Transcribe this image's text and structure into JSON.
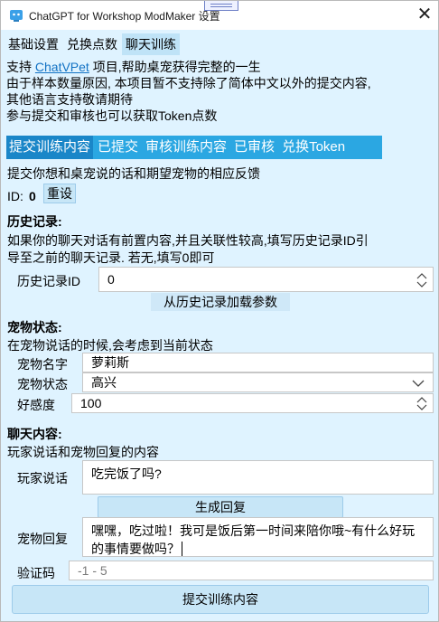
{
  "window": {
    "title": "ChatGPT for Workshop ModMaker 设置"
  },
  "main_tabs": [
    {
      "label": "基础设置"
    },
    {
      "label": "兑换点数"
    },
    {
      "label": "聊天训练"
    }
  ],
  "intro": {
    "line1_prefix": "支持 ",
    "line1_link": "ChatVPet",
    "line1_suffix": " 项目,帮助桌宠获得完整的一生",
    "line2": "由于样本数量原因, 本项目暂不支持除了简体中文以外的提交内容,",
    "line3": "其他语言支持敬请期待",
    "line4": "参与提交和审核也可以获取Token点数"
  },
  "sub_tabs": [
    {
      "label": "提交训练内容"
    },
    {
      "label": "已提交"
    },
    {
      "label": "审核训练内容"
    },
    {
      "label": "已审核"
    },
    {
      "label": "兑换Token"
    }
  ],
  "form": {
    "description": "提交你想和桌宠说的话和期望宠物的相应反馈",
    "id_label": "ID:",
    "id_value": "0",
    "reset_button": "重设",
    "history": {
      "heading": "历史记录:",
      "desc_line1": "如果你的聊天对话有前置内容,并且关联性较高,填写历史记录ID引",
      "desc_line2": "导至之前的聊天记录. 若无,填写0即可",
      "id_label": "历史记录ID",
      "id_value": "0",
      "load_button": "从历史记录加载参数"
    },
    "pet_state": {
      "heading": "宠物状态:",
      "desc": "在宠物说话的时候,会考虑到当前状态",
      "name_label": "宠物名字",
      "name_value": "萝莉斯",
      "state_label": "宠物状态",
      "state_value": "高兴",
      "favor_label": "好感度",
      "favor_value": "100"
    },
    "chat": {
      "heading": "聊天内容:",
      "desc": "玩家说话和宠物回复的内容",
      "player_label": "玩家说话",
      "player_value": "吃完饭了吗?",
      "generate_button": "生成回复",
      "reply_label": "宠物回复",
      "reply_value": "嘿嘿，吃过啦！我可是饭后第一时间来陪你哦~有什么好玩的事情要做吗？",
      "captcha_label": "验证码",
      "captcha_placeholder": "-1 - 5"
    },
    "submit_button": "提交训练内容"
  },
  "colors": {
    "window_bg": "#dff3ff",
    "sub_tab_bar": "#2ba7e2",
    "active_tab": "#bfe3f7",
    "link": "#1272c4",
    "button": "#c7e6f7"
  },
  "icons": [
    "app-icon",
    "close-icon",
    "spin-up-icon",
    "spin-down-icon",
    "chevron-down-icon"
  ]
}
